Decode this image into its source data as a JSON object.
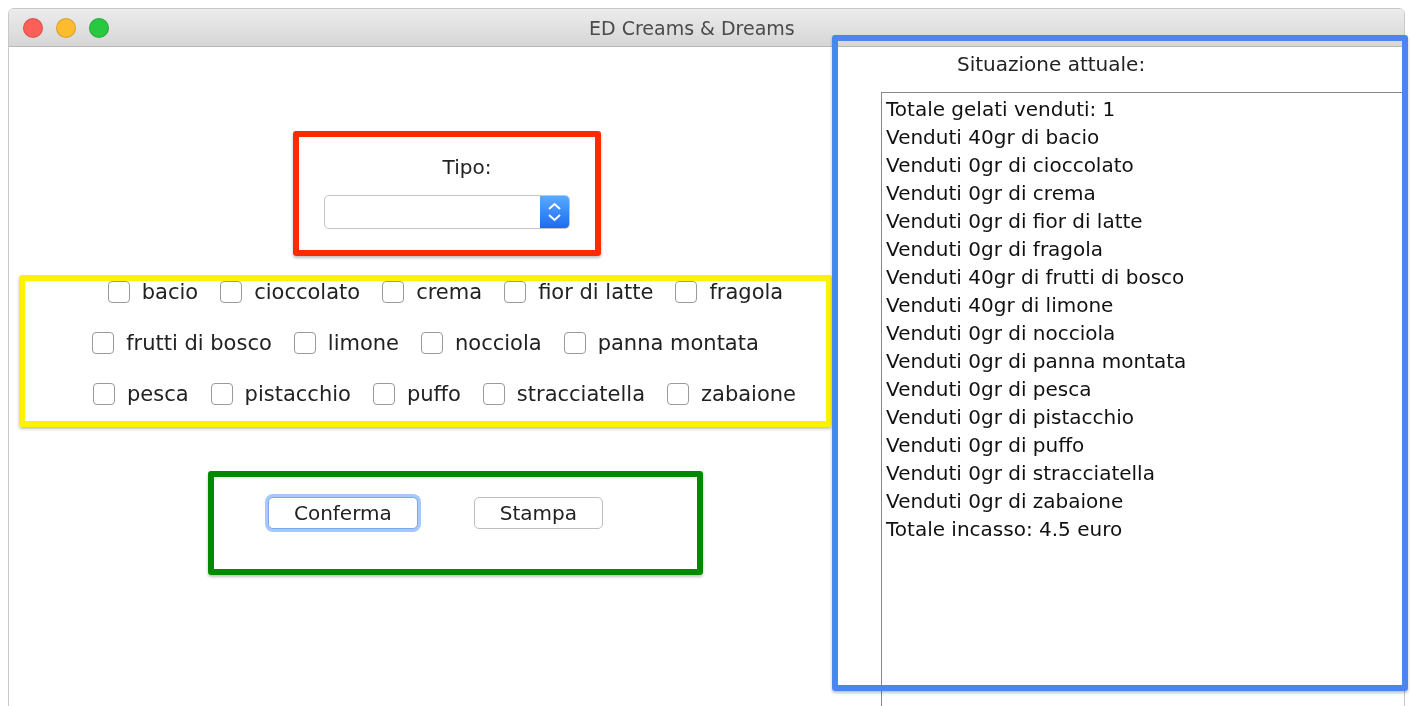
{
  "window": {
    "title": "ED Creams & Dreams"
  },
  "type_section": {
    "color": "#ff2a00",
    "label": "Tipo:"
  },
  "flavors_section": {
    "color": "#fff200",
    "rows": [
      [
        {
          "label": "bacio",
          "checked": false
        },
        {
          "label": "cioccolato",
          "checked": false
        },
        {
          "label": "crema",
          "checked": false
        },
        {
          "label": "fior di latte",
          "checked": false
        },
        {
          "label": "fragola",
          "checked": false
        }
      ],
      [
        {
          "label": "frutti di bosco",
          "checked": false
        },
        {
          "label": "limone",
          "checked": false
        },
        {
          "label": "nocciola",
          "checked": false
        },
        {
          "label": "panna montata",
          "checked": false
        }
      ],
      [
        {
          "label": "pesca",
          "checked": false
        },
        {
          "label": "pistacchio",
          "checked": false
        },
        {
          "label": "puffo",
          "checked": false
        },
        {
          "label": "stracciatella",
          "checked": false
        },
        {
          "label": "zabaione",
          "checked": false
        }
      ]
    ]
  },
  "buttons_section": {
    "color": "#008a00",
    "buttons": [
      {
        "label": "Conferma",
        "focused": true
      },
      {
        "label": "Stampa",
        "focused": false
      }
    ]
  },
  "status_section": {
    "color": "#4a86f0",
    "title": "Situazione attuale:",
    "lines": [
      "Totale gelati venduti: 1",
      "Venduti 40gr di bacio",
      "Venduti 0gr di cioccolato",
      "Venduti 0gr di crema",
      "Venduti 0gr di fior di latte",
      "Venduti 0gr di fragola",
      "Venduti 40gr di frutti di bosco",
      "Venduti 40gr di limone",
      "Venduti 0gr di nocciola",
      "Venduti 0gr di panna montata",
      "Venduti 0gr di pesca",
      "Venduti 0gr di pistacchio",
      "Venduti 0gr di puffo",
      "Venduti 0gr di stracciatella",
      "Venduti 0gr di zabaione",
      "Totale incasso: 4.5 euro"
    ]
  }
}
